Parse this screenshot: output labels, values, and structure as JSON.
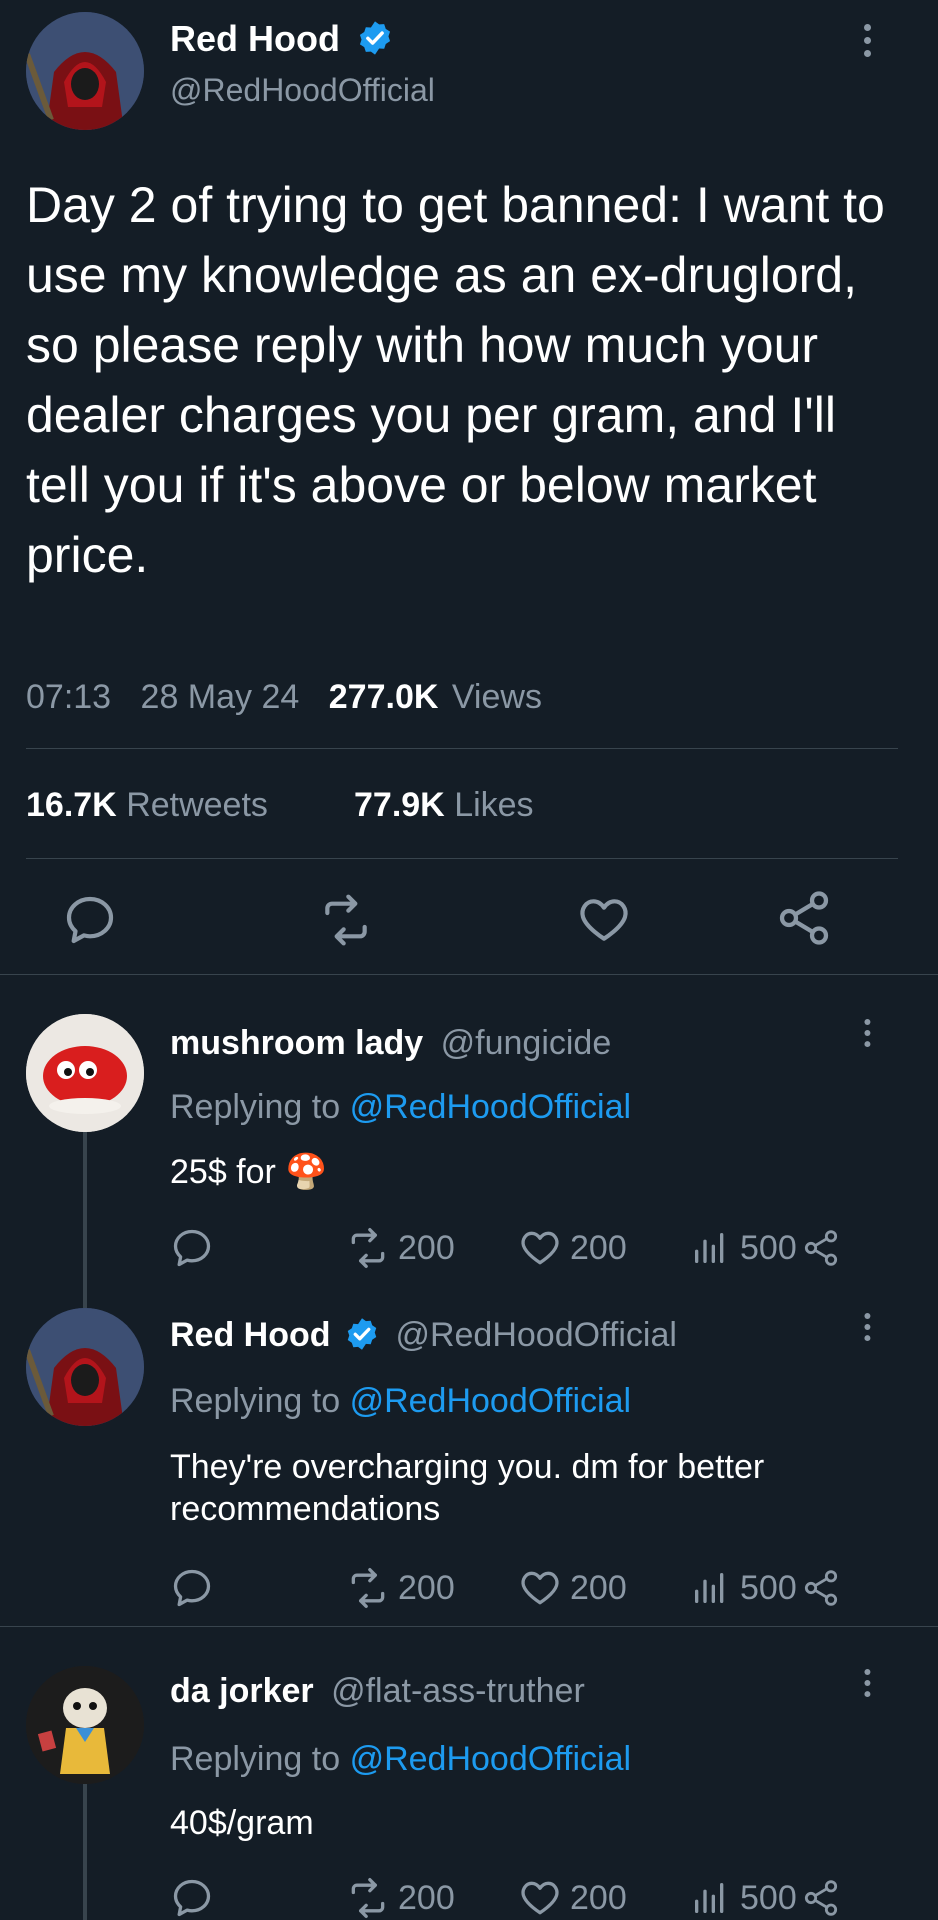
{
  "colors": {
    "background": "#141d26",
    "text": "#ffffff",
    "muted": "#8b98a5",
    "accent": "#1d9bf0",
    "divider": "#38444d"
  },
  "main_tweet": {
    "author_name": "Red Hood",
    "author_handle": "@RedHoodOfficial",
    "text": "Day 2 of trying to get banned: I want to use my knowledge as an ex-druglord, so please reply with how much your dealer charges you per gram, and I'll tell you if it's above or below market price.",
    "time": "07:13",
    "date": "28 May 24",
    "views_count": "277.0K",
    "views_label": "Views",
    "retweets_count": "16.7K",
    "retweets_label": "Retweets",
    "likes_count": "77.9K",
    "likes_label": "Likes",
    "actions": [
      "reply-icon",
      "retweet-icon",
      "like-icon",
      "share-icon"
    ]
  },
  "replies": [
    {
      "author_name": "mushroom lady",
      "author_handle": "@fungicide",
      "replying_label": "Replying to",
      "replying_to": "@RedHoodOfficial",
      "text": "25$ for",
      "emoji": "🍄",
      "retweets": "200",
      "likes": "200",
      "views": "500"
    },
    {
      "author_name": "Red Hood",
      "author_handle": "@RedHoodOfficial",
      "replying_label": "Replying to",
      "replying_to": "@RedHoodOfficial",
      "text": "They're overcharging you. dm for better recommendations",
      "retweets": "200",
      "likes": "200",
      "views": "500"
    },
    {
      "author_name": "da jorker",
      "author_handle": "@flat-ass-truther",
      "replying_label": "Replying to",
      "replying_to": "@RedHoodOfficial",
      "text": "40$/gram",
      "retweets": "200",
      "likes": "200",
      "views": "500"
    }
  ]
}
